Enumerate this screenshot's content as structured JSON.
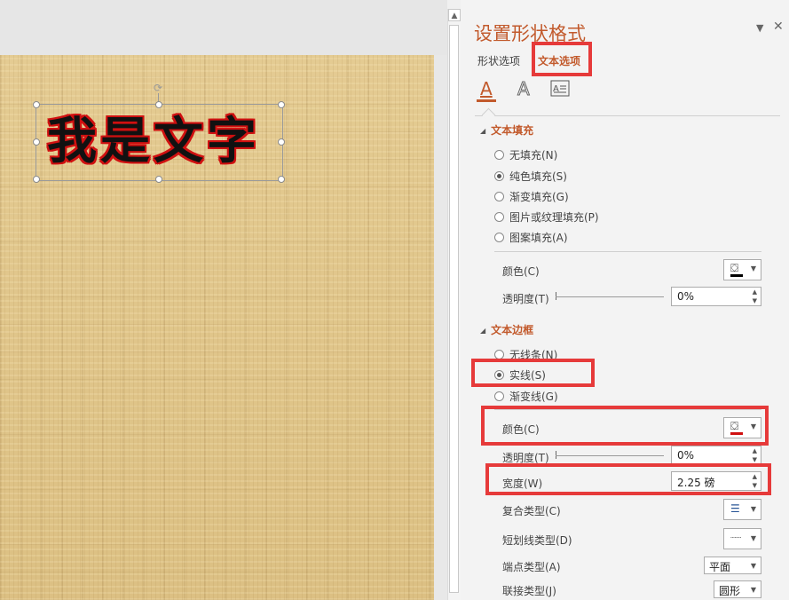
{
  "slide": {
    "text": "我是文字",
    "text_fill_color": "#111111",
    "text_outline_color": "#d01010"
  },
  "panel": {
    "title": "设置形状格式",
    "tabs": [
      "形状选项",
      "文本选项"
    ],
    "active_tab": "文本选项",
    "icons": {
      "text_fill_outline": "text-fill-outline-icon",
      "text_effects": "text-effects-icon",
      "textbox": "textbox-icon"
    },
    "fill": {
      "header": "文本填充",
      "options": [
        "无填充(N)",
        "纯色填充(S)",
        "渐变填充(G)",
        "图片或纹理填充(P)",
        "图案填充(A)"
      ],
      "selected": "纯色填充(S)",
      "color_label": "颜色(C)",
      "color_value": "#000000",
      "transparency_label": "透明度(T)",
      "transparency_value": "0%"
    },
    "border": {
      "header": "文本边框",
      "options": [
        "无线条(N)",
        "实线(S)",
        "渐变线(G)"
      ],
      "selected": "实线(S)",
      "color_label": "颜色(C)",
      "color_value": "#d01010",
      "transparency_label": "透明度(T)",
      "transparency_value": "0%",
      "width_label": "宽度(W)",
      "width_value": "2.25 磅",
      "compound_label": "复合类型(C)",
      "dash_label": "短划线类型(D)",
      "cap_label": "端点类型(A)",
      "cap_value": "平面",
      "join_label": "联接类型(J)",
      "join_value": "圆形"
    }
  },
  "highlight_color": "#e63a3a",
  "accent_color": "#c25a2c"
}
